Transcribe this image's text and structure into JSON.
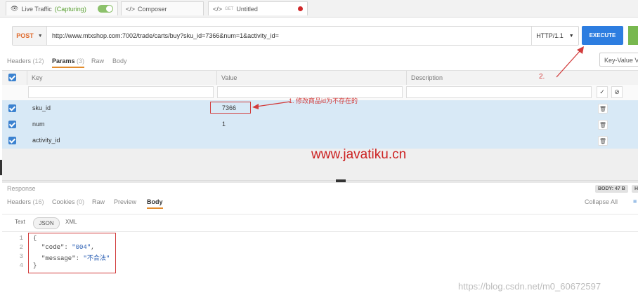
{
  "tabs": [
    {
      "label": "Live Traffic",
      "extra": "(Capturing)",
      "icon": "eye-icon"
    },
    {
      "label": "Composer",
      "icon": "code-icon"
    },
    {
      "label": "Untitled",
      "prefix": "GET",
      "icon": "code-icon"
    }
  ],
  "request": {
    "method": "POST",
    "url": "http://www.mtxshop.com:7002/trade/carts/buy?sku_id=7366&num=1&activity_id=",
    "protocol": "HTTP/1.1",
    "execute_label": "EXECUTE"
  },
  "request_tabs": {
    "headers": "Headers",
    "headers_count": "(12)",
    "params": "Params",
    "params_count": "(3)",
    "raw": "Raw",
    "body": "Body"
  },
  "kv_select": "Key-Value Vi",
  "params_table": {
    "headers": [
      "Key",
      "Value",
      "Description"
    ],
    "rows": [
      {
        "key": "sku_id",
        "value": "7366"
      },
      {
        "key": "num",
        "value": "1"
      },
      {
        "key": "activity_id",
        "value": ""
      }
    ]
  },
  "annotations": {
    "note1": "1.  修改商品id为不存在的",
    "note2": "2.",
    "watermark": "www.javatiku.cn",
    "csdn": "https://blog.csdn.net/m0_60672597"
  },
  "response": {
    "label": "Response",
    "body_size": "BODY: 47 B",
    "extra_badge": "H",
    "tabs": {
      "headers": "Headers",
      "headers_count": "(16)",
      "cookies": "Cookies",
      "cookies_count": "(0)",
      "raw": "Raw",
      "preview": "Preview",
      "body": "Body"
    },
    "collapse": "Collapse All",
    "formats": {
      "text": "Text",
      "json": "JSON",
      "xml": "XML"
    },
    "lines": [
      "1",
      "2",
      "3",
      "4"
    ],
    "code": {
      "open": "{",
      "key1": "\"code\"",
      "val1": "\"004\"",
      "key2": "\"message\"",
      "val2": "\"不合法\"",
      "close": "}"
    }
  },
  "colors": {
    "accent": "#2d7de0",
    "method": "#e06a2c",
    "annotation": "#d23c3c",
    "selected_row": "#d8e9f6"
  }
}
